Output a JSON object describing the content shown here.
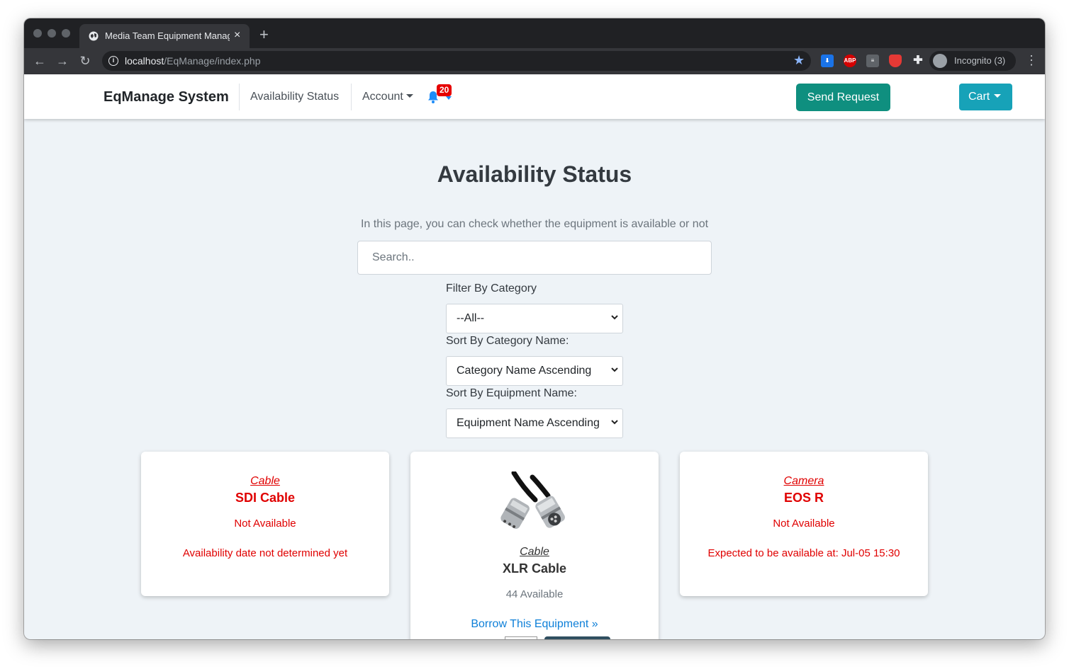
{
  "browser": {
    "tab_title": "Media Team Equipment Management",
    "url_host": "localhost",
    "url_path": "/EqManage/index.php",
    "incognito_label": "Incognito (3)",
    "extensions": [
      "download-icon",
      "adblock-icon",
      "reader-icon",
      "shield-icon",
      "puzzle-icon"
    ],
    "ext_abp_label": "ABP"
  },
  "navbar": {
    "brand": "EqManage System",
    "link_availability": "Availability Status",
    "link_account": "Account",
    "notification_count": "20",
    "send_request": "Send Request",
    "cart": "Cart"
  },
  "page": {
    "title": "Availability Status",
    "description": "In this page, you can check whether the equipment is available or not",
    "search_placeholder": "Search..",
    "filter_label": "Filter By Category",
    "filter_value": "--All--",
    "sort_category_label": "Sort By Category Name:",
    "sort_category_value": "Category Name Ascending",
    "sort_equipment_label": "Sort By Equipment Name:",
    "sort_equipment_value": "Equipment Name Ascending"
  },
  "cards": [
    {
      "category": "Cable",
      "name": "SDI Cable",
      "status": "Not Available",
      "detail": "Availability date not determined yet"
    },
    {
      "category": "Cable",
      "name": "XLR Cable",
      "status": "44 Available",
      "link": "Borrow This Equipment »"
    },
    {
      "category": "Camera",
      "name": "EOS R",
      "status": "Not Available",
      "detail": "Expected to be available at: Jul-05 15:30"
    }
  ],
  "colors": {
    "unavailable": "#e00000",
    "send_button": "#0f8f7f",
    "cart_button": "#17a2b8",
    "link": "#0d7fd8"
  }
}
